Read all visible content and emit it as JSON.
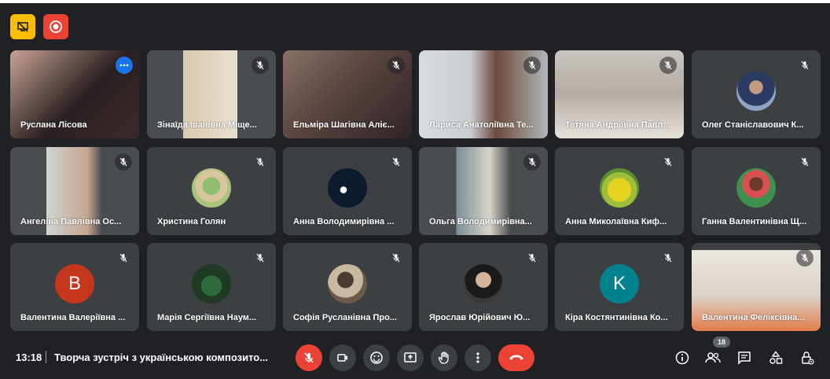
{
  "top": {
    "icons": [
      "screen-share-off-icon",
      "record-icon"
    ]
  },
  "participants": [
    {
      "name": "Руслана Лісова",
      "type": "video",
      "active": true
    },
    {
      "name": "Зінаїда Іванівна Міще...",
      "type": "video"
    },
    {
      "name": "Ельміра Шагівна Аліє...",
      "type": "video"
    },
    {
      "name": "Лариса Анатоліївна Те...",
      "type": "video"
    },
    {
      "name": "Тетяна Андріївна Павл...",
      "type": "video"
    },
    {
      "name": "Олег Станіславович К...",
      "type": "avatar"
    },
    {
      "name": "Ангеліна Павлівна Ос...",
      "type": "video"
    },
    {
      "name": "Христина Голян",
      "type": "avatar"
    },
    {
      "name": "Анна Володимирівна ...",
      "type": "avatar"
    },
    {
      "name": "Ольга Володимирівна...",
      "type": "video"
    },
    {
      "name": "Анна Миколаївна Киф...",
      "type": "avatar"
    },
    {
      "name": "Ганна Валентинівна Щ...",
      "type": "avatar"
    },
    {
      "name": "Валентина Валеріївна ...",
      "type": "letter",
      "letter": "В",
      "color": "#c5371c"
    },
    {
      "name": "Марія Сергіївна Наум...",
      "type": "avatar"
    },
    {
      "name": "Софія Русланівна Про...",
      "type": "avatar"
    },
    {
      "name": "Ярослав Юрійович Ю...",
      "type": "avatar"
    },
    {
      "name": "Кіра Костянтинівна Ко...",
      "type": "letter",
      "letter": "K",
      "color": "#00838f"
    },
    {
      "name": "Валентина Феліксівна...",
      "type": "video"
    }
  ],
  "bottom": {
    "time": "13:18",
    "meeting_title": "Творча зустріч з українською композито...",
    "participant_count": "18"
  },
  "colors": {
    "accent": "#8ab4f8",
    "danger": "#ea4335",
    "tile": "#3c4043",
    "background": "#202124"
  }
}
